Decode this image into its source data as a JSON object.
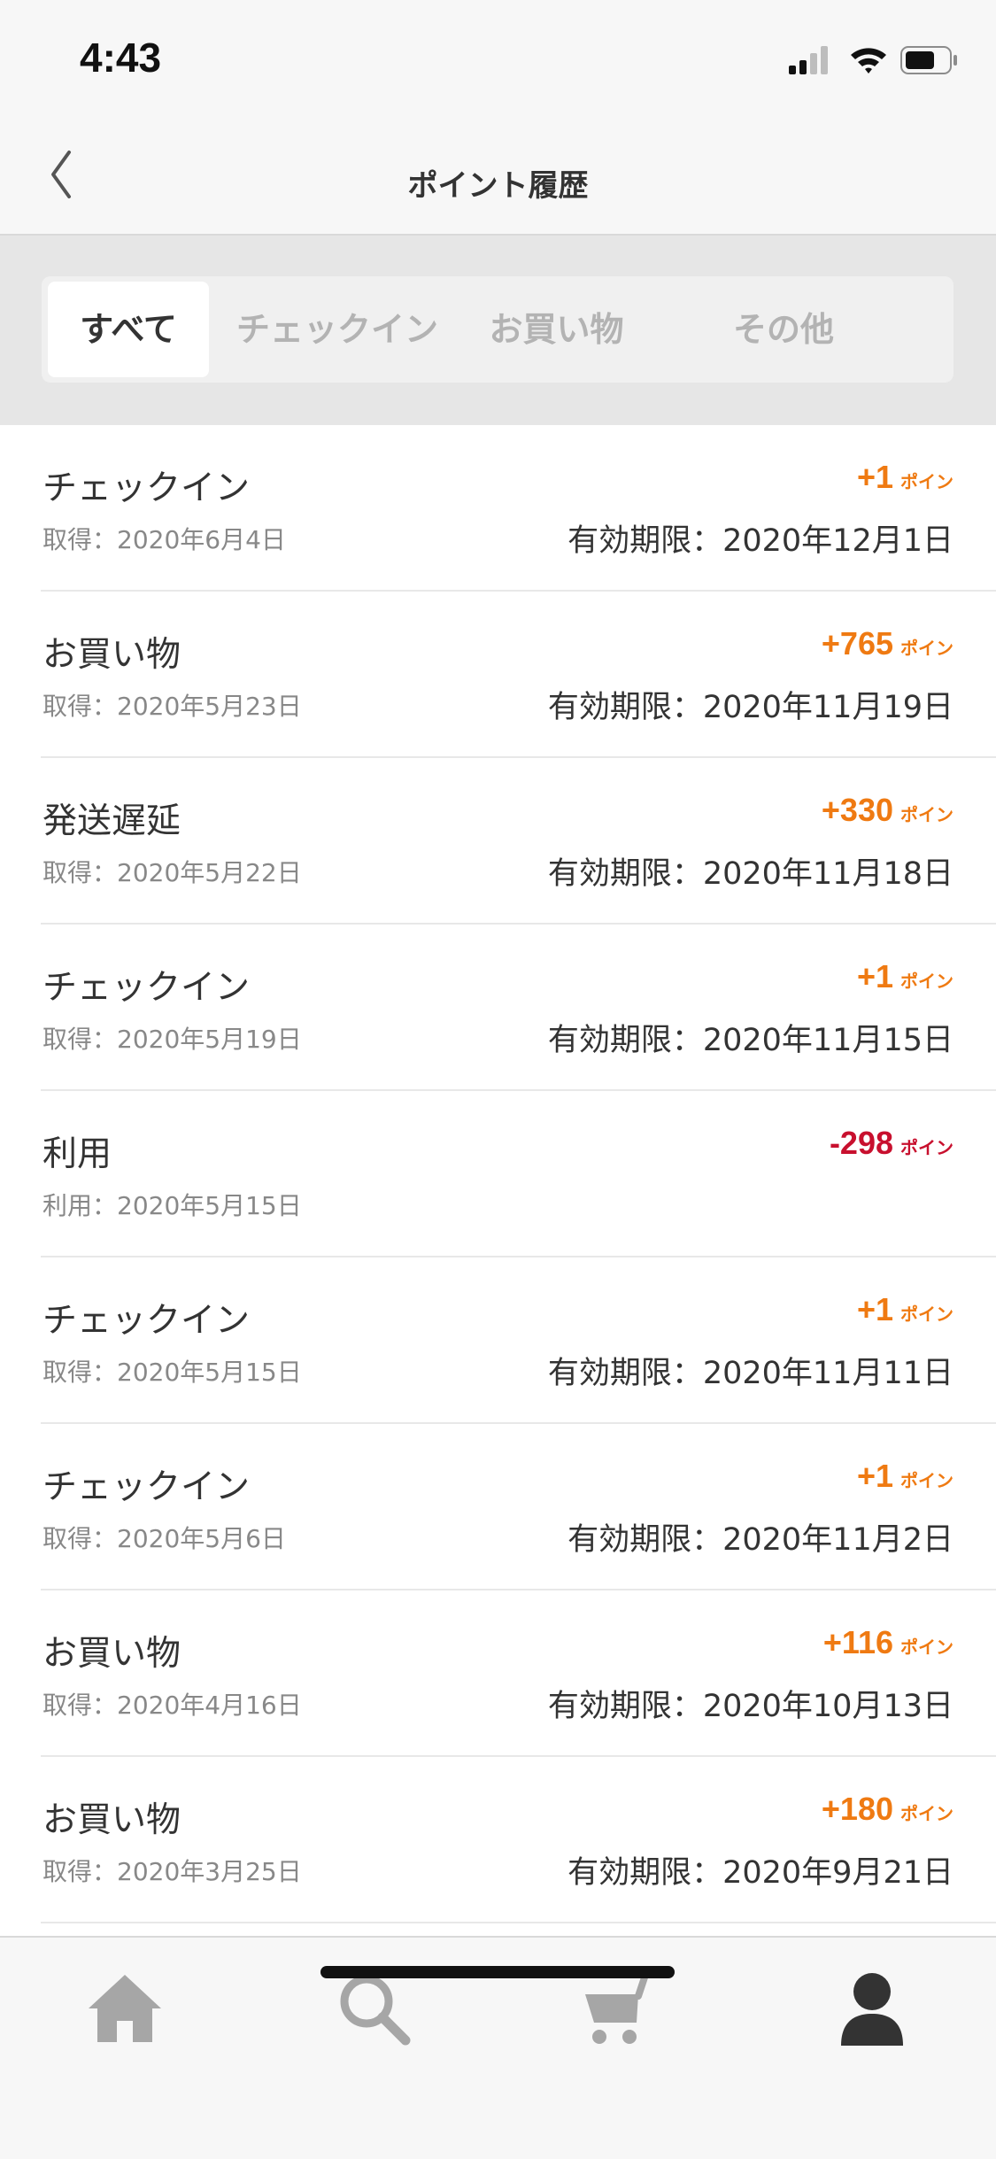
{
  "status_bar": {
    "time": "4:43",
    "icons": [
      "signal-icon",
      "wifi-icon",
      "battery-icon"
    ]
  },
  "nav": {
    "title": "ポイント履歴",
    "back_icon": "chevron-left-icon"
  },
  "tabs": [
    {
      "label": "すべて",
      "active": true
    },
    {
      "label": "チェックイン",
      "active": false
    },
    {
      "label": "お買い物",
      "active": false
    },
    {
      "label": "その他",
      "active": false
    }
  ],
  "history": [
    {
      "title": "チェックイン",
      "date": "取得：2020年6月4日",
      "points": "+1",
      "unit": "ポイン",
      "expiry": "有効期限：2020年12月1日",
      "negative": false
    },
    {
      "title": "お買い物",
      "date": "取得：2020年5月23日",
      "points": "+765",
      "unit": "ポイン",
      "expiry": "有効期限：2020年11月19日",
      "negative": false
    },
    {
      "title": "発送遅延",
      "date": "取得：2020年5月22日",
      "points": "+330",
      "unit": "ポイン",
      "expiry": "有効期限：2020年11月18日",
      "negative": false
    },
    {
      "title": "チェックイン",
      "date": "取得：2020年5月19日",
      "points": "+1",
      "unit": "ポイン",
      "expiry": "有効期限：2020年11月15日",
      "negative": false
    },
    {
      "title": "利用",
      "date": "利用：2020年5月15日",
      "points": "-298",
      "unit": "ポイン",
      "expiry": "",
      "negative": true
    },
    {
      "title": "チェックイン",
      "date": "取得：2020年5月15日",
      "points": "+1",
      "unit": "ポイン",
      "expiry": "有効期限：2020年11月11日",
      "negative": false
    },
    {
      "title": "チェックイン",
      "date": "取得：2020年5月6日",
      "points": "+1",
      "unit": "ポイン",
      "expiry": "有効期限：2020年11月2日",
      "negative": false
    },
    {
      "title": "お買い物",
      "date": "取得：2020年4月16日",
      "points": "+116",
      "unit": "ポイン",
      "expiry": "有効期限：2020年10月13日",
      "negative": false
    },
    {
      "title": "お買い物",
      "date": "取得：2020年3月25日",
      "points": "+180",
      "unit": "ポイン",
      "expiry": "有効期限：2020年9月21日",
      "negative": false
    }
  ],
  "tab_bar": [
    {
      "icon": "home-icon",
      "active": false
    },
    {
      "icon": "search-icon",
      "active": false
    },
    {
      "icon": "cart-icon",
      "active": false
    },
    {
      "icon": "user-icon",
      "active": true
    }
  ],
  "colors": {
    "positive_points": "#ef7a12",
    "negative_points": "#c8102e",
    "inactive_icon": "#a6a6a6",
    "active_icon": "#333333"
  }
}
